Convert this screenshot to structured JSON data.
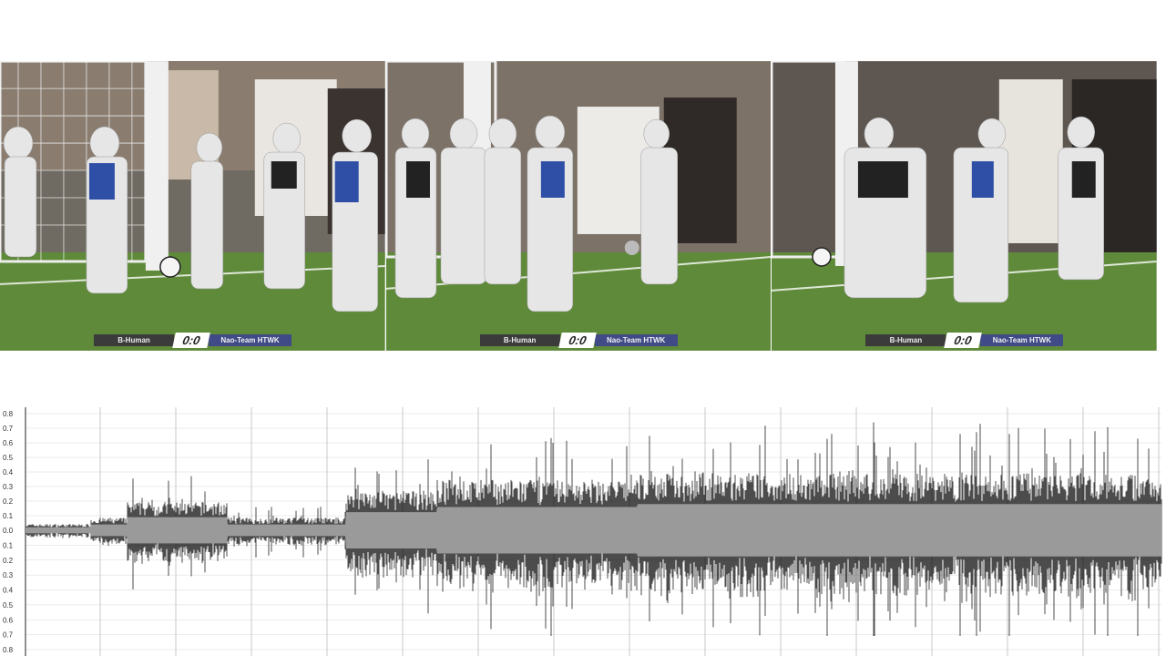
{
  "frames": [
    {
      "team_left": "B-Human",
      "score": "0:0",
      "team_right": "Nao-Team HTWK"
    },
    {
      "team_left": "B-Human",
      "score": "0:0",
      "team_right": "Nao-Team HTWK"
    },
    {
      "team_left": "B-Human",
      "score": "0:0",
      "team_right": "Nao-Team HTWK"
    }
  ],
  "waveform": {
    "y_ticks_upper": [
      "0.8",
      "0.7",
      "0.6",
      "0.5",
      "0.4",
      "0.3",
      "0.2",
      "0.1",
      "0.0"
    ],
    "y_ticks_lower": [
      "0.1",
      "0.2",
      "0.3",
      "0.4",
      "0.5",
      "0.6",
      "0.7",
      "0.8"
    ],
    "colors": {
      "signal": "#000000",
      "envelope": "#9a9a9a",
      "grid": "#d8d8d8",
      "axis": "#222222"
    }
  }
}
